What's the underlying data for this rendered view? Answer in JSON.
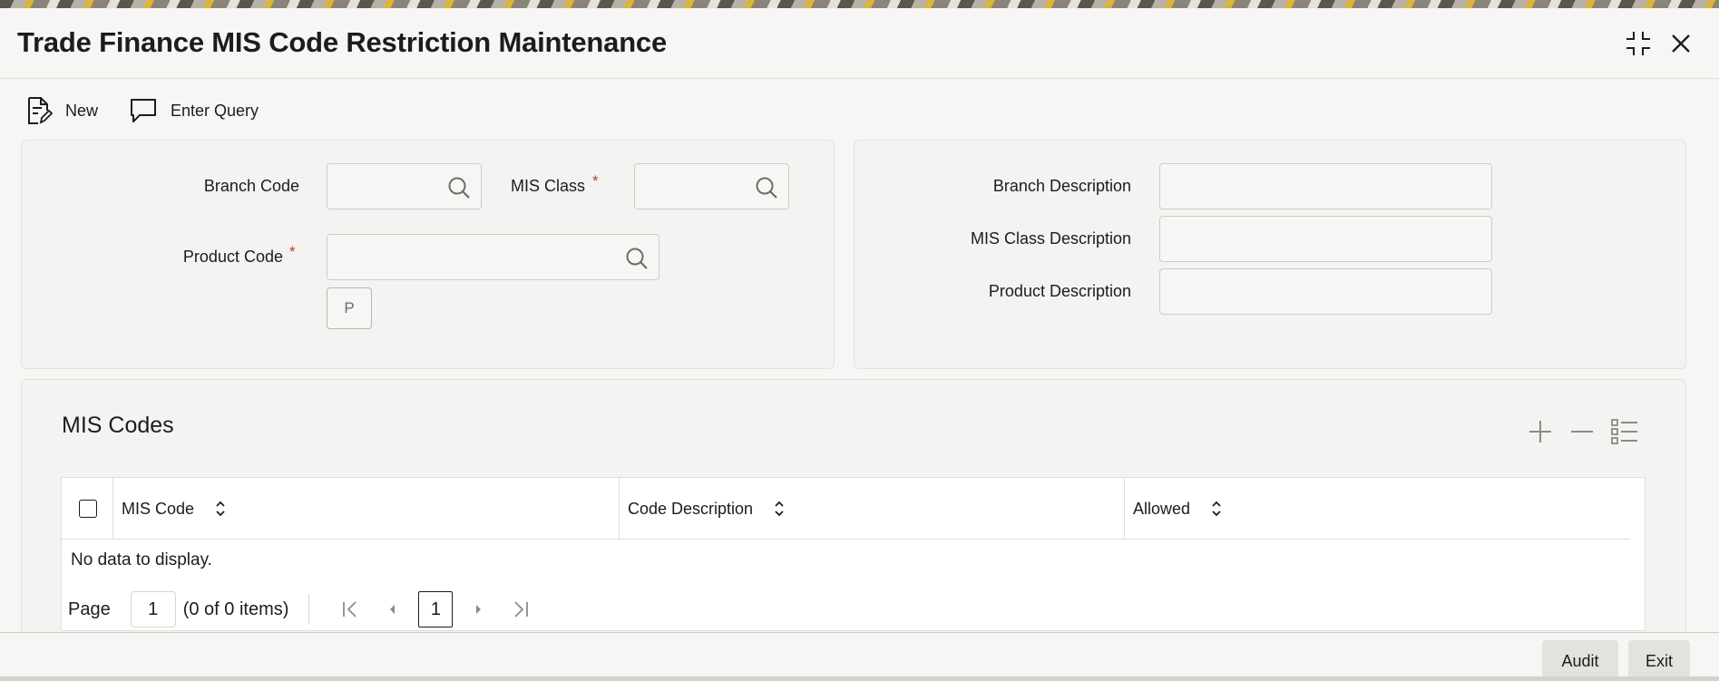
{
  "window": {
    "title": "Trade Finance MIS Code Restriction Maintenance",
    "maximize_icon": "maximize-icon",
    "close_icon": "close-icon"
  },
  "toolbar": {
    "new_label": "New",
    "enter_query_label": "Enter Query"
  },
  "form": {
    "branch_code_label": "Branch Code",
    "branch_code_value": "",
    "mis_class_label": "MIS Class",
    "mis_class_value": "",
    "product_code_label": "Product Code",
    "product_code_value": "",
    "required_marker": "*",
    "p_button_label": "P",
    "branch_description_label": "Branch Description",
    "branch_description_value": "",
    "mis_class_description_label": "MIS Class Description",
    "mis_class_description_value": "",
    "product_description_label": "Product Description",
    "product_description_value": ""
  },
  "grid": {
    "title": "MIS Codes",
    "columns": [
      "MIS Code",
      "Code Description",
      "Allowed"
    ],
    "rows": [],
    "empty_text": "No data to display.",
    "pager": {
      "page_label": "Page",
      "page_value": "1",
      "items_text": "(0 of 0 items)",
      "current_page": "1"
    }
  },
  "footer": {
    "audit_label": "Audit",
    "exit_label": "Exit"
  },
  "colors": {
    "required": "#b5402b",
    "panel_bg": "#f4f3f1",
    "footer_button_bg": "#e4e2de"
  }
}
